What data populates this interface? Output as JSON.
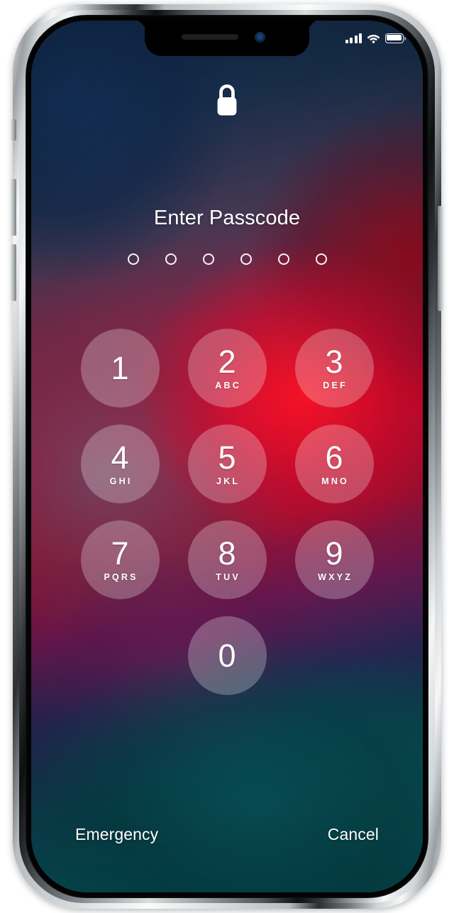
{
  "device": {
    "name": "iPhone X",
    "frame_color": "#c8ccd0"
  },
  "status_bar": {
    "signal_icon": "cellular-signal-icon",
    "signal_bars_active": 4,
    "signal_bars_total": 4,
    "wifi_icon": "wifi-icon",
    "wifi_strength": "full",
    "battery_icon": "battery-icon",
    "battery_level_percent": 85
  },
  "lock_screen": {
    "lock_icon": "lock-closed-icon",
    "title": "Enter Passcode",
    "passcode": {
      "length": 6,
      "entered": 0,
      "dots": [
        "empty",
        "empty",
        "empty",
        "empty",
        "empty",
        "empty"
      ]
    }
  },
  "keypad": {
    "rows": [
      [
        {
          "digit": "1",
          "letters": ""
        },
        {
          "digit": "2",
          "letters": "ABC"
        },
        {
          "digit": "3",
          "letters": "DEF"
        }
      ],
      [
        {
          "digit": "4",
          "letters": "GHI"
        },
        {
          "digit": "5",
          "letters": "JKL"
        },
        {
          "digit": "6",
          "letters": "MNO"
        }
      ],
      [
        {
          "digit": "7",
          "letters": "PQRS"
        },
        {
          "digit": "8",
          "letters": "TUV"
        },
        {
          "digit": "9",
          "letters": "WXYZ"
        }
      ],
      [
        {
          "digit": "0",
          "letters": ""
        }
      ]
    ]
  },
  "bottom_actions": {
    "emergency_label": "Emergency",
    "cancel_label": "Cancel"
  },
  "colors": {
    "text": "#ffffff",
    "key_fill": "rgba(255,255,255,0.26)",
    "wallpaper_blue": "#112b4d",
    "wallpaper_red": "#c2082e",
    "wallpaper_teal": "#06525c"
  }
}
